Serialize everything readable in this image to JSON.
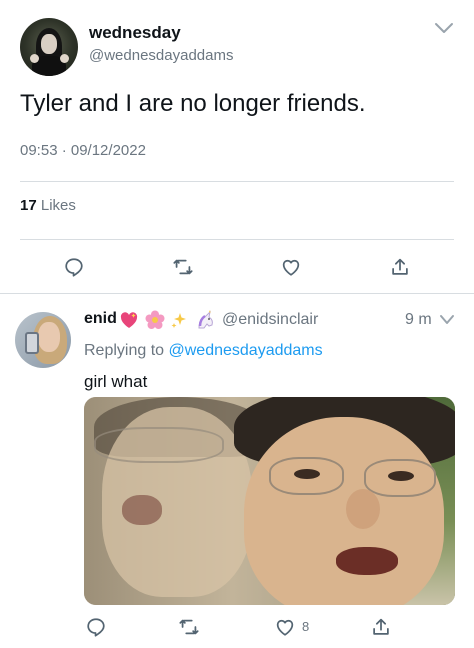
{
  "main_tweet": {
    "display_name": "wednesday",
    "handle": "@wednesdayaddams",
    "text": "Tyler and I are no longer friends.",
    "timestamp": "09:53 · 09/12/2022",
    "likes_count": "17",
    "likes_label": "Likes"
  },
  "reply": {
    "display_name": "enid",
    "handle": "@enidsinclair",
    "time": "9 m",
    "replying_prefix": "Replying to",
    "replying_to": "@wednesdayaddams",
    "text": "girl what",
    "like_count": "8"
  },
  "icons": [
    "chevron-down-icon",
    "reply-icon",
    "retweet-icon",
    "like-icon",
    "share-icon",
    "heart-emoji",
    "flower-emoji",
    "sparkles-emoji",
    "unicorn-emoji"
  ],
  "colors": {
    "text": "#0f1419",
    "secondary": "#6b7680",
    "link": "#1d9bf0",
    "divider": "#d8dde1",
    "icon": "#536471"
  }
}
